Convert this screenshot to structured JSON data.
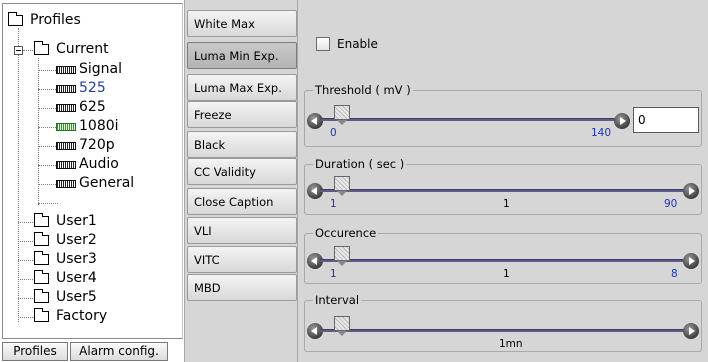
{
  "tree": {
    "nodes": [
      {
        "label": "Profiles"
      },
      {
        "label": "Current"
      },
      {
        "label": "Signal"
      },
      {
        "label": "525"
      },
      {
        "label": "625"
      },
      {
        "label": "1080i"
      },
      {
        "label": "720p"
      },
      {
        "label": "Audio"
      },
      {
        "label": "General"
      },
      {
        "label": "User1"
      },
      {
        "label": "User2"
      },
      {
        "label": "User3"
      },
      {
        "label": "User4"
      },
      {
        "label": "User5"
      },
      {
        "label": "Factory"
      }
    ],
    "selected": "525"
  },
  "bottom_tabs": [
    "Profiles",
    "Alarm config."
  ],
  "menu": {
    "items": [
      "White Max",
      "Luma Min Exp.",
      "Luma Max Exp.",
      "Freeze",
      "Black",
      "CC Validity",
      "Close Caption",
      "VLI",
      "VITC",
      "MBD"
    ],
    "active": "Luma Min Exp."
  },
  "content": {
    "enable_label": "Enable",
    "enable_checked": false,
    "threshold": {
      "title": "Threshold ( mV )",
      "min": "0",
      "max": "140",
      "value": "0",
      "field_value": "0",
      "level": 0
    },
    "duration": {
      "title": "Duration ( sec )",
      "min": "1",
      "max": "90",
      "value": "1",
      "level": 0
    },
    "occurence": {
      "title": "Occurence",
      "min": "1",
      "max": "8",
      "value": "1",
      "level": 0
    },
    "interval": {
      "title": "Interval",
      "value": "1mn",
      "level": 0
    }
  },
  "colors": {
    "panel_bg": "#d6d6d6",
    "track": "#5c5c86",
    "tick_blue": "#1a33c8",
    "card_green": "#22a422"
  },
  "icons": {
    "folder": "folder-icon",
    "card": "card-icon",
    "arrow_left": "arrow-left-icon",
    "arrow_right": "arrow-right-icon"
  }
}
